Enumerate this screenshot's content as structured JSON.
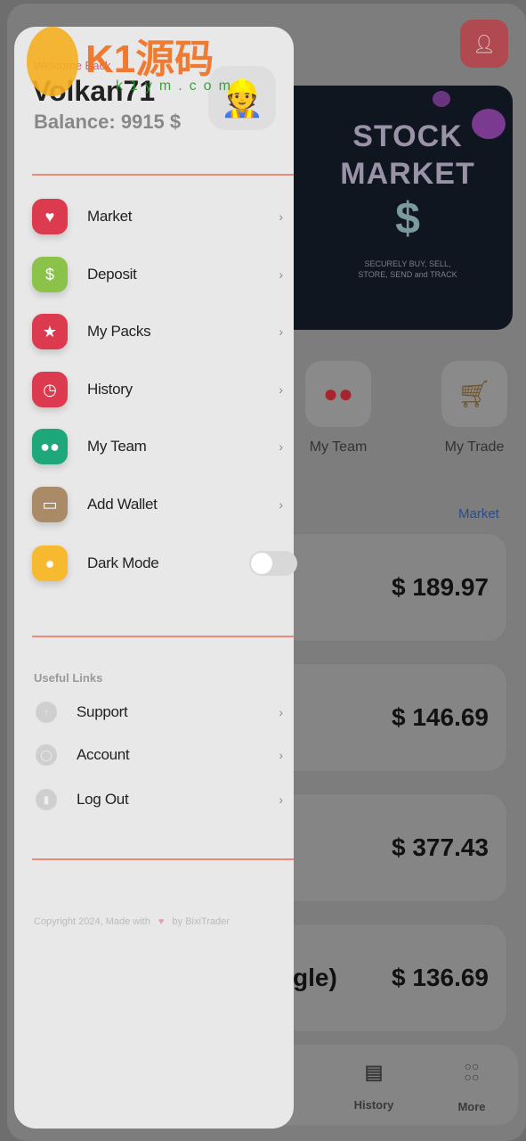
{
  "watermark": {
    "brand": "K1源码",
    "url": "k1ym.com"
  },
  "drawer": {
    "welcome": "Welcome Back",
    "username": "Volkan71",
    "balance": "Balance: 9915 $",
    "menu": [
      {
        "label": "Market",
        "icon": "heart-icon",
        "color": "#dc3a4f"
      },
      {
        "label": "Deposit",
        "icon": "wallet-money-icon",
        "color": "#8bc34a"
      },
      {
        "label": "My Packs",
        "icon": "star-icon",
        "color": "#dc3a4f"
      },
      {
        "label": "History",
        "icon": "clock-icon",
        "color": "#dc3a4f"
      },
      {
        "label": "My Team",
        "icon": "users-icon",
        "color": "#1ea77a"
      },
      {
        "label": "Add Wallet",
        "icon": "wallet-icon",
        "color": "#a98b68"
      },
      {
        "label": "Dark Mode",
        "icon": "lightbulb-icon",
        "color": "#f6b92f"
      }
    ],
    "dark_mode_on": false,
    "useful_links_title": "Useful Links",
    "useful_links": [
      {
        "label": "Support",
        "icon": "arrow-up-circle-icon"
      },
      {
        "label": "Account",
        "icon": "user-circle-icon"
      },
      {
        "label": "Log Out",
        "icon": "signal-bars-icon"
      }
    ],
    "copyright_prefix": "Copyright 2024, Made with",
    "copyright_suffix": "by BixiTrader",
    "accent": "#ee8a78"
  },
  "background": {
    "banner": {
      "line1": "STOCK",
      "line2": "MARKET",
      "symbol": "$",
      "tagline1": "SECURELY BUY, SELL,",
      "tagline2": "STORE, SEND and TRACK"
    },
    "quick": [
      {
        "label": "My Team"
      },
      {
        "label": "My Trade"
      }
    ],
    "market_link": "Market",
    "cards": [
      {
        "price": "$ 189.97",
        "name": ""
      },
      {
        "price": "$ 146.69",
        "name": ""
      },
      {
        "price": "$ 377.43",
        "name": ""
      },
      {
        "price": "$ 136.69",
        "name": "gle)"
      }
    ],
    "nav": [
      {
        "label": "History"
      },
      {
        "label": "More"
      }
    ]
  }
}
